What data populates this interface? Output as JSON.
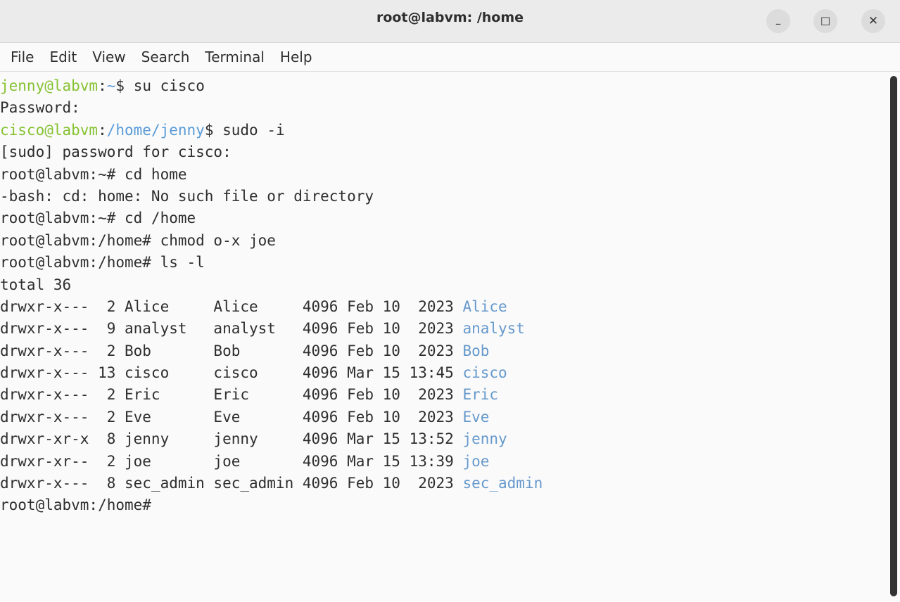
{
  "window": {
    "title": "root@labvm: /home",
    "min_glyph": "–",
    "max_glyph": "☐",
    "close_glyph": "✕"
  },
  "menu": [
    "File",
    "Edit",
    "View",
    "Search",
    "Terminal",
    "Help"
  ],
  "colors": {
    "prompt_user": "#86c232",
    "prompt_path": "#5a9bd8",
    "directory": "#6699cc",
    "text": "#2e2e2e"
  },
  "terminal": {
    "lines": [
      {
        "type": "prompt_colored",
        "user": "jenny@labvm",
        "sep": ":",
        "path": "~",
        "sym": "$ ",
        "cmd": "su cisco"
      },
      {
        "type": "text",
        "text": "Password:"
      },
      {
        "type": "prompt_colored",
        "user": "cisco@labvm",
        "sep": ":",
        "path": "/home/jenny",
        "sym": "$ ",
        "cmd": "sudo -i"
      },
      {
        "type": "text",
        "text": "[sudo] password for cisco:"
      },
      {
        "type": "text",
        "text": "root@labvm:~# cd home"
      },
      {
        "type": "text",
        "text": "-bash: cd: home: No such file or directory"
      },
      {
        "type": "text",
        "text": "root@labvm:~# cd /home"
      },
      {
        "type": "text",
        "text": "root@labvm:/home# chmod o-x joe"
      },
      {
        "type": "text",
        "text": "root@labvm:/home# ls -l"
      },
      {
        "type": "text",
        "text": "total 36"
      },
      {
        "type": "ls",
        "prefix": "drwxr-x---  2 Alice     Alice     4096 Feb 10  2023 ",
        "name": "Alice"
      },
      {
        "type": "ls",
        "prefix": "drwxr-x---  9 analyst   analyst   4096 Feb 10  2023 ",
        "name": "analyst"
      },
      {
        "type": "ls",
        "prefix": "drwxr-x---  2 Bob       Bob       4096 Feb 10  2023 ",
        "name": "Bob"
      },
      {
        "type": "ls",
        "prefix": "drwxr-x--- 13 cisco     cisco     4096 Mar 15 13:45 ",
        "name": "cisco"
      },
      {
        "type": "ls",
        "prefix": "drwxr-x---  2 Eric      Eric      4096 Feb 10  2023 ",
        "name": "Eric"
      },
      {
        "type": "ls",
        "prefix": "drwxr-x---  2 Eve       Eve       4096 Feb 10  2023 ",
        "name": "Eve"
      },
      {
        "type": "ls",
        "prefix": "drwxr-xr-x  8 jenny     jenny     4096 Mar 15 13:52 ",
        "name": "jenny"
      },
      {
        "type": "ls",
        "prefix": "drwxr-xr--  2 joe       joe       4096 Mar 15 13:39 ",
        "name": "joe"
      },
      {
        "type": "ls",
        "prefix": "drwxr-x---  8 sec_admin sec_admin 4096 Feb 10  2023 ",
        "name": "sec_admin"
      },
      {
        "type": "text",
        "text": "root@labvm:/home#"
      }
    ]
  }
}
